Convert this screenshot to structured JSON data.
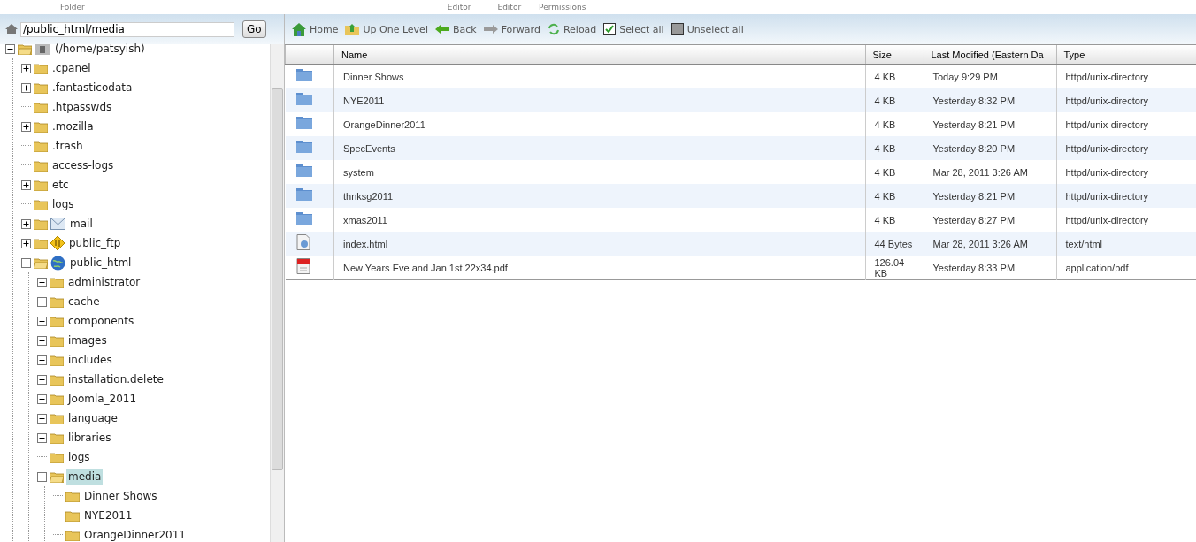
{
  "top_labels": [
    "Folder",
    "Editor",
    "Editor",
    "Permissions"
  ],
  "path_bar": {
    "value": "/public_html/media",
    "button": "Go"
  },
  "tree": {
    "label": "(/home/patsyish)",
    "kind": "home",
    "expanded": true,
    "selected": false,
    "children": [
      {
        "label": ".cpanel",
        "kind": "folder",
        "expanded": false,
        "selected": false
      },
      {
        "label": ".fantasticodata",
        "kind": "folder",
        "expanded": false,
        "selected": false
      },
      {
        "label": ".htpasswds",
        "kind": "folder",
        "selected": false
      },
      {
        "label": ".mozilla",
        "kind": "folder",
        "expanded": false,
        "selected": false
      },
      {
        "label": ".trash",
        "kind": "folder",
        "selected": false
      },
      {
        "label": "access-logs",
        "kind": "folder",
        "selected": false
      },
      {
        "label": "etc",
        "kind": "folder",
        "expanded": false,
        "selected": false
      },
      {
        "label": "logs",
        "kind": "folder",
        "selected": false
      },
      {
        "label": "mail",
        "kind": "mail",
        "expanded": false,
        "selected": false
      },
      {
        "label": "public_ftp",
        "kind": "ftp",
        "expanded": false,
        "selected": false
      },
      {
        "label": "public_html",
        "kind": "web",
        "expanded": true,
        "selected": false,
        "children": [
          {
            "label": "administrator",
            "kind": "folder",
            "expanded": false,
            "selected": false
          },
          {
            "label": "cache",
            "kind": "folder",
            "expanded": false,
            "selected": false
          },
          {
            "label": "components",
            "kind": "folder",
            "expanded": false,
            "selected": false
          },
          {
            "label": "images",
            "kind": "folder",
            "expanded": false,
            "selected": false
          },
          {
            "label": "includes",
            "kind": "folder",
            "expanded": false,
            "selected": false
          },
          {
            "label": "installation.delete",
            "kind": "folder",
            "expanded": false,
            "selected": false
          },
          {
            "label": "Joomla_2011",
            "kind": "folder",
            "expanded": false,
            "selected": false
          },
          {
            "label": "language",
            "kind": "folder",
            "expanded": false,
            "selected": false
          },
          {
            "label": "libraries",
            "kind": "folder",
            "expanded": false,
            "selected": false
          },
          {
            "label": "logs",
            "kind": "folder",
            "selected": false
          },
          {
            "label": "media",
            "kind": "folder",
            "expanded": true,
            "selected": true,
            "children": [
              {
                "label": "Dinner Shows",
                "kind": "folder",
                "selected": false
              },
              {
                "label": "NYE2011",
                "kind": "folder",
                "selected": false
              },
              {
                "label": "OrangeDinner2011",
                "kind": "folder",
                "selected": false
              }
            ]
          }
        ]
      }
    ]
  },
  "toolbar": [
    {
      "label": "Home",
      "kind": "home"
    },
    {
      "label": "Up One Level",
      "kind": "up"
    },
    {
      "label": "Back",
      "kind": "back"
    },
    {
      "label": "Forward",
      "kind": "forward"
    },
    {
      "label": "Reload",
      "kind": "reload"
    },
    {
      "label": "Select all",
      "kind": "select"
    },
    {
      "label": "Unselect all",
      "kind": "unselect"
    }
  ],
  "table": {
    "columns": [
      "Name",
      "Size",
      "Last Modified (Eastern Da",
      "Type"
    ],
    "rows": [
      {
        "kind": "folder",
        "name": "Dinner Shows",
        "size": "4 KB",
        "modified": "Today 9:29 PM",
        "type": "httpd/unix-directory"
      },
      {
        "kind": "folder",
        "name": "NYE2011",
        "size": "4 KB",
        "modified": "Yesterday 8:32 PM",
        "type": "httpd/unix-directory"
      },
      {
        "kind": "folder",
        "name": "OrangeDinner2011",
        "size": "4 KB",
        "modified": "Yesterday 8:21 PM",
        "type": "httpd/unix-directory"
      },
      {
        "kind": "folder",
        "name": "SpecEvents",
        "size": "4 KB",
        "modified": "Yesterday 8:20 PM",
        "type": "httpd/unix-directory"
      },
      {
        "kind": "folder",
        "name": "system",
        "size": "4 KB",
        "modified": "Mar 28, 2011 3:26 AM",
        "type": "httpd/unix-directory"
      },
      {
        "kind": "folder",
        "name": "thnksg2011",
        "size": "4 KB",
        "modified": "Yesterday 8:21 PM",
        "type": "httpd/unix-directory"
      },
      {
        "kind": "folder",
        "name": "xmas2011",
        "size": "4 KB",
        "modified": "Yesterday 8:27 PM",
        "type": "httpd/unix-directory"
      },
      {
        "kind": "html",
        "name": "index.html",
        "size": "44 Bytes",
        "modified": "Mar 28, 2011 3:26 AM",
        "type": "text/html"
      },
      {
        "kind": "pdf",
        "name": "New Years Eve and Jan 1st 22x34.pdf",
        "size": "126.04 KB",
        "modified": "Yesterday 8:33 PM",
        "type": "application/pdf"
      }
    ]
  }
}
